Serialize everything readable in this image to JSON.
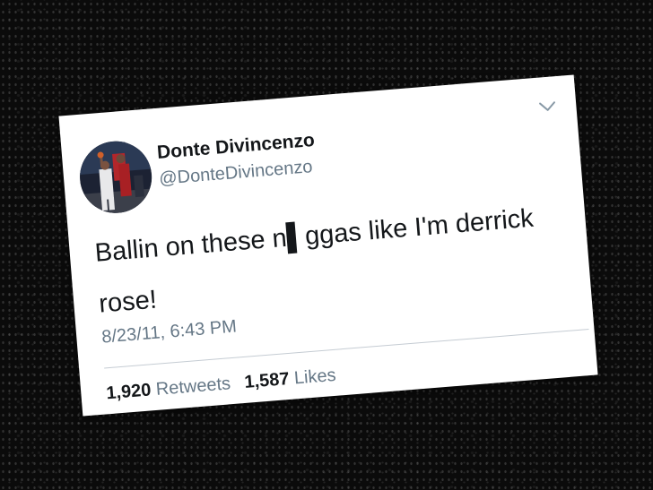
{
  "tweet": {
    "author_name": "Donte Divincenzo",
    "author_handle": "@DonteDivincenzo",
    "text_line1": "Ballin on these n▌ggas like I'm derrick",
    "text_line2": "rose!",
    "timestamp": "8/23/11, 6:43 PM",
    "retweets_count": "1,920",
    "retweets_label": "Retweets",
    "likes_count": "1,587",
    "likes_label": "Likes"
  },
  "icons": {
    "menu": "chevron-down-icon",
    "avatar": "avatar"
  },
  "colors": {
    "background": "#0b0b0b",
    "card": "#ffffff",
    "text_primary": "#14171a",
    "text_secondary": "#657786",
    "divider": "#c5ccd3"
  }
}
